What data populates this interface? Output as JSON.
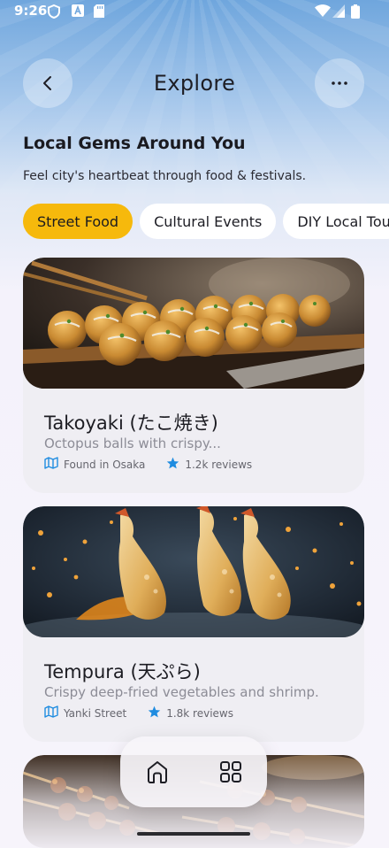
{
  "status_bar": {
    "time": "9:26"
  },
  "header": {
    "title": "Explore"
  },
  "intro": {
    "headline": "Local Gems Around You",
    "subline": "Feel city's heartbeat through food & festivals."
  },
  "chips": [
    {
      "label": "Street Food",
      "active": true
    },
    {
      "label": "Cultural Events",
      "active": false
    },
    {
      "label": "DIY Local Tou",
      "active": false
    }
  ],
  "cards": [
    {
      "name": "Takoyaki (たこ焼き)",
      "description": "Octopus balls with crispy...",
      "location": "Found in Osaka",
      "reviews": "1.2k reviews"
    },
    {
      "name": "Tempura (天ぷら)",
      "description": "Crispy deep-fried vegetables and shrimp.",
      "location": "Yanki Street",
      "reviews": "1.8k reviews"
    }
  ],
  "colors": {
    "accent": "#f6b90c",
    "star": "#1f8ce0",
    "card_bg": "#efeef3"
  },
  "icons": [
    "back-arrow-icon",
    "more-icon",
    "map-icon",
    "star-icon",
    "home-icon",
    "grid-icon"
  ]
}
